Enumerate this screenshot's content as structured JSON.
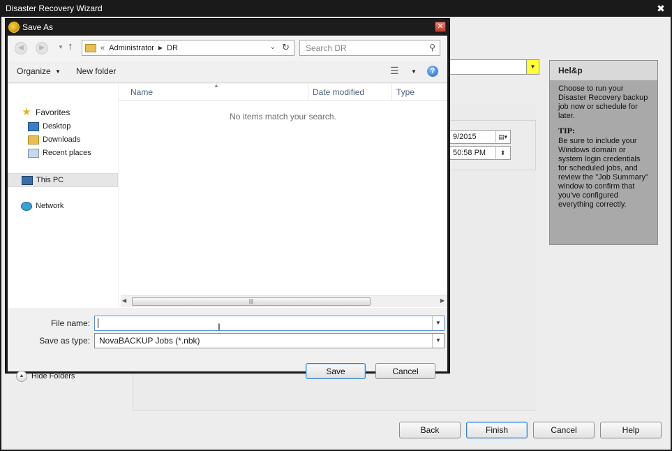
{
  "wizard": {
    "title": "Disaster Recovery Wizard",
    "close_glyph": "✖",
    "date_value": "9/2015",
    "time_value": "50:58 PM",
    "buttons": {
      "back": "Back",
      "finish": "Finish",
      "cancel": "Cancel",
      "help": "Help"
    }
  },
  "help_panel": {
    "title": "Hel&p",
    "intro": "Choose to run your Disaster Recovery backup job now or schedule for later.",
    "tip_title": "TIP:",
    "tip_text": "Be sure to include your Windows domain or system login credentials for scheduled jobs, and review the \"Job Summary\" window to confirm that you've configured everything correctly."
  },
  "save_dialog": {
    "title": "Save As",
    "address": {
      "prefix": "«",
      "crumbs": [
        "Administrator",
        "DR"
      ]
    },
    "search_placeholder": "Search DR",
    "toolbar": {
      "organize": "Organize",
      "new_folder": "New folder"
    },
    "nav_tree": {
      "favorites": "Favorites",
      "desktop": "Desktop",
      "downloads": "Downloads",
      "recent": "Recent places",
      "this_pc": "This PC",
      "network": "Network"
    },
    "columns": [
      "Name",
      "Date modified",
      "Type"
    ],
    "empty_message": "No items match your search.",
    "file_name_label": "File name:",
    "file_name_value": "",
    "save_type_label": "Save as type:",
    "save_type_value": "NovaBACKUP Jobs (*.nbk)",
    "hide_folders": "Hide Folders",
    "save_button": "Save",
    "cancel_button": "Cancel"
  }
}
